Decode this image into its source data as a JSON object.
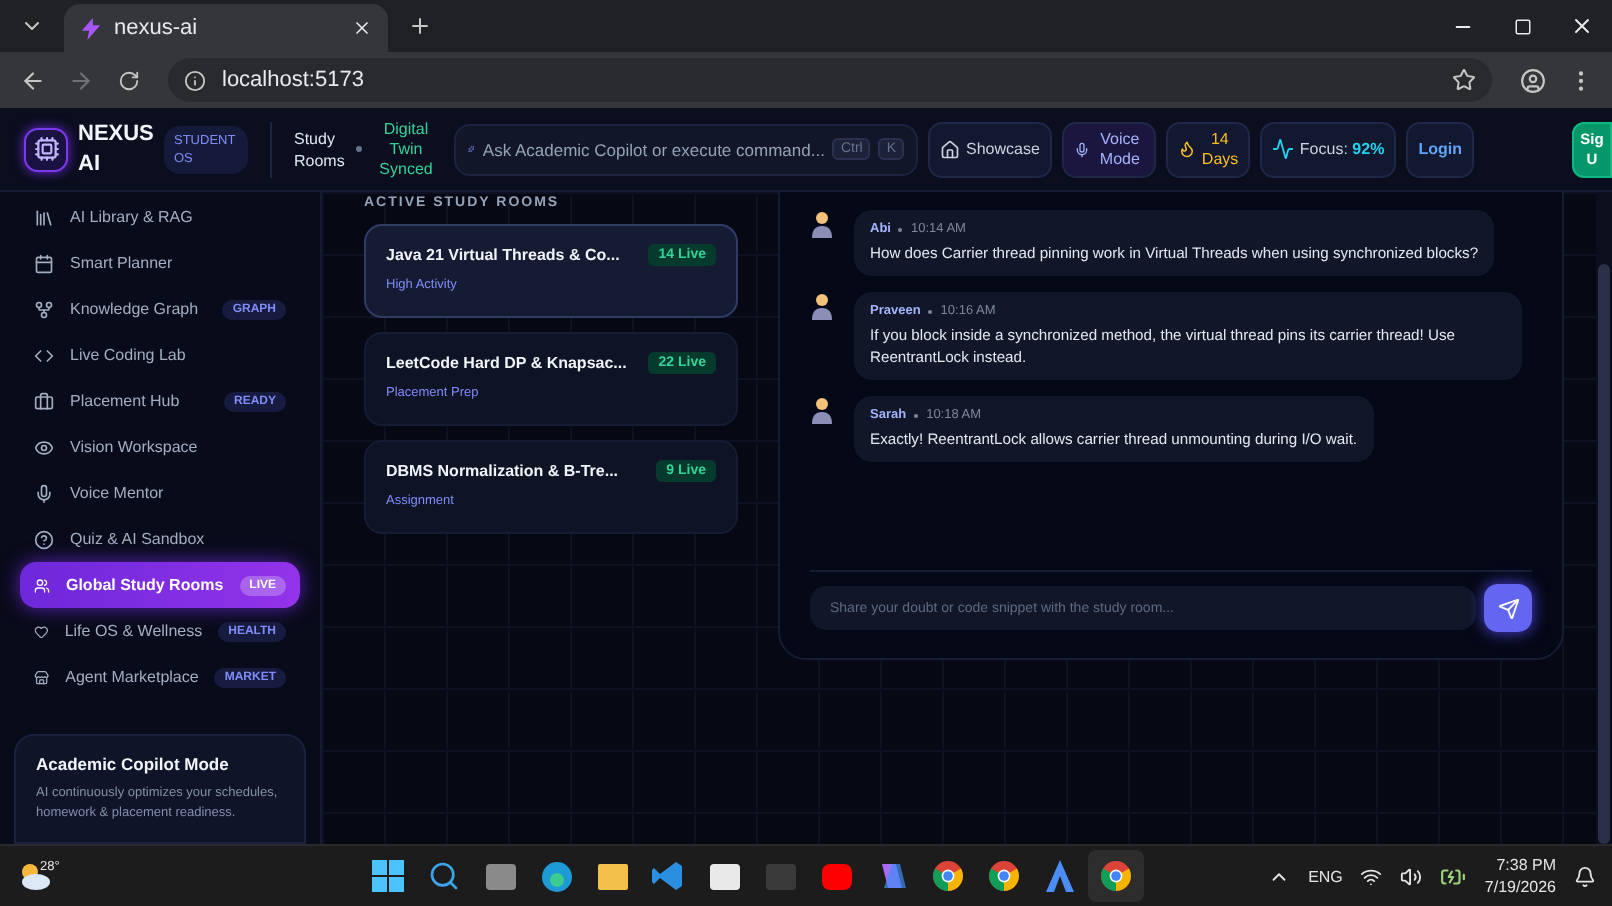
{
  "browser": {
    "tab_title": "nexus-ai",
    "url": "localhost:5173"
  },
  "header": {
    "brand": "NEXUS AI",
    "badge": "STUDENT OS",
    "page_title": "Study Rooms",
    "sync_status": "Digital Twin Synced",
    "search_placeholder": "Ask Academic Copilot or execute command...",
    "shortcut_keys": [
      "Ctrl",
      "K"
    ],
    "actions": [
      {
        "kind": "showcase",
        "label": "Showcase"
      },
      {
        "kind": "voice",
        "label": "Voice Mode"
      },
      {
        "kind": "streak",
        "label": "14 Days"
      },
      {
        "kind": "focus",
        "label": "Focus:",
        "value": "92%"
      },
      {
        "kind": "login",
        "label": "Login"
      },
      {
        "kind": "signup",
        "label": "Sig U"
      }
    ]
  },
  "sidebar": {
    "items": [
      {
        "label": "AI Library & RAG",
        "selected": false
      },
      {
        "label": "Smart Planner",
        "selected": false
      },
      {
        "label": "Knowledge Graph",
        "badge": "GRAPH",
        "selected": false
      },
      {
        "label": "Live Coding Lab",
        "selected": false
      },
      {
        "label": "Placement Hub",
        "badge": "READY",
        "selected": false
      },
      {
        "label": "Vision Workspace",
        "selected": false
      },
      {
        "label": "Voice Mentor",
        "selected": false
      },
      {
        "label": "Quiz & AI Sandbox",
        "selected": false
      },
      {
        "label": "Global Study Rooms",
        "badge": "LIVE",
        "selected": true
      },
      {
        "label": "Life OS & Wellness",
        "badge": "HEALTH",
        "selected": false
      },
      {
        "label": "Agent Marketplace",
        "badge": "MARKET",
        "selected": false
      }
    ],
    "card": {
      "title": "Academic Copilot Mode",
      "text": "AI continuously optimizes your schedules, homework & placement readiness."
    }
  },
  "rooms": {
    "heading": "ACTIVE STUDY ROOMS",
    "items": [
      {
        "title": "Java 21 Virtual Threads & Co...",
        "count": "14 Live",
        "tag": "High Activity",
        "selected": true
      },
      {
        "title": "LeetCode Hard DP & Knapsac...",
        "count": "22 Live",
        "tag": "Placement Prep",
        "selected": false
      },
      {
        "title": "DBMS Normalization & B-Tre...",
        "count": "9 Live",
        "tag": "Assignment",
        "selected": false
      }
    ]
  },
  "chat": {
    "messages": [
      {
        "author": "Abi",
        "time": "10:14 AM",
        "text": "How does Carrier thread pinning work in Virtual Threads when using synchronized blocks?"
      },
      {
        "author": "Praveen",
        "time": "10:16 AM",
        "text": "If you block inside a synchronized method, the virtual thread pins its carrier thread! Use ReentrantLock instead."
      },
      {
        "author": "Sarah",
        "time": "10:18 AM",
        "text": "Exactly! ReentrantLock allows carrier thread unmounting during I/O wait."
      }
    ],
    "input_placeholder": "Share your doubt or code snippet with the study room..."
  },
  "taskbar": {
    "weather": "28°",
    "language": "ENG",
    "time": "7:38 PM",
    "date": "7/19/2026"
  }
}
